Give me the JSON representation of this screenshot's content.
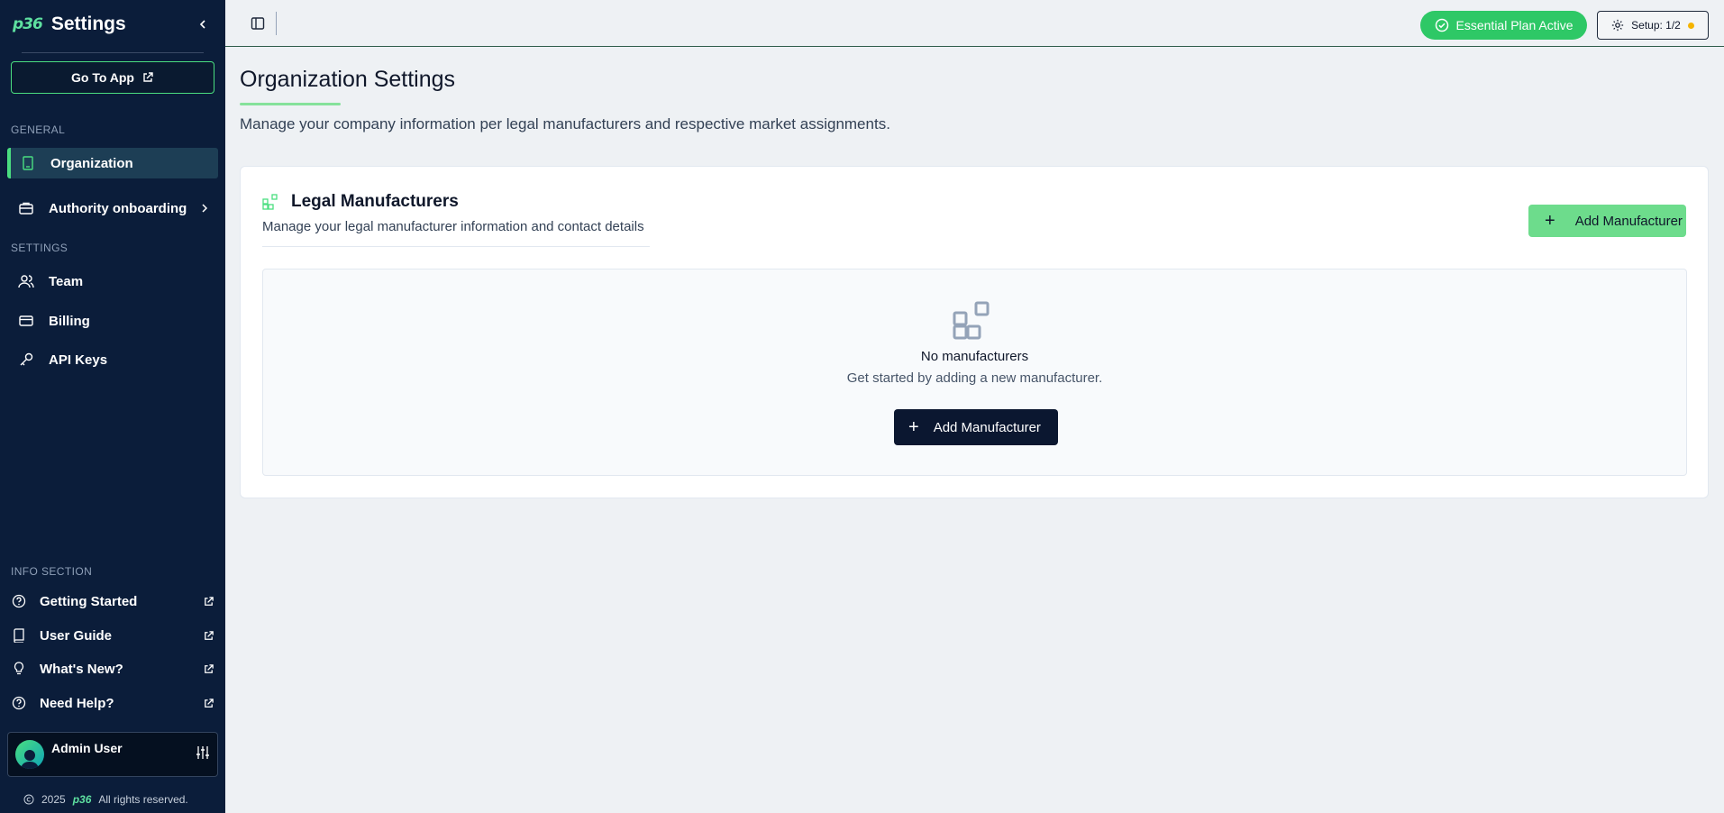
{
  "sidebar": {
    "logo": "p36",
    "title": "Settings",
    "goto_label": "Go To App",
    "general_label": "GENERAL",
    "settings_label": "SETTINGS",
    "info_label": "INFO SECTION",
    "nav": {
      "organization": "Organization",
      "authority": "Authority onboarding",
      "team": "Team",
      "billing": "Billing",
      "api_keys": "API Keys"
    },
    "info": {
      "getting_started": "Getting Started",
      "user_guide": "User Guide",
      "whats_new": "What's New?",
      "need_help": "Need Help?"
    },
    "user": {
      "name": "Admin User"
    },
    "footer": {
      "year": "2025",
      "logo": "p36",
      "rights": "All rights reserved."
    }
  },
  "topbar": {
    "plan": "Essential Plan Active",
    "setup": "Setup: 1/2"
  },
  "main": {
    "title": "Organization Settings",
    "subtitle": "Manage your company information per legal manufacturers and respective market assignments.",
    "card": {
      "title": "Legal Manufacturers",
      "subtitle": "Manage your legal manufacturer information and contact details",
      "add_label": "Add Manufacturer",
      "empty_title": "No manufacturers",
      "empty_desc": "Get started by adding a new manufacturer.",
      "empty_add_label": "Add Manufacturer"
    }
  },
  "colors": {
    "sidebar_bg": "#0b1d3a",
    "accent_green": "#4ade80",
    "plan_badge": "#2ec866",
    "setup_dot": "#f5b400"
  }
}
